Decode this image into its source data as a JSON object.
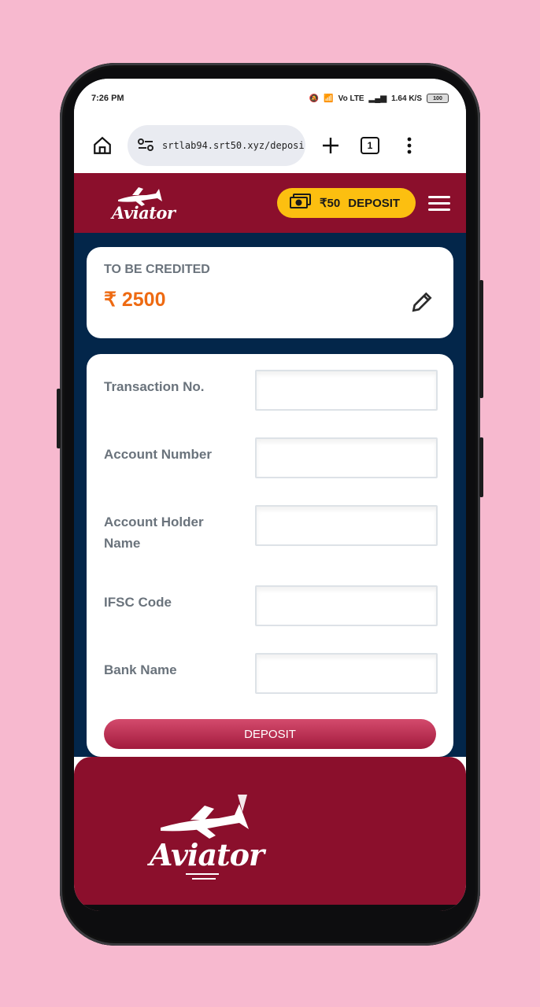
{
  "status_bar": {
    "time": "7:26 PM",
    "network": "Vo LTE",
    "speed": "1.64 K/S",
    "battery": "100"
  },
  "browser": {
    "url": "srtlab94.srt50.xyz/deposi",
    "tab_count": "1"
  },
  "app_header": {
    "logo_text": "Aviator",
    "balance": "₹50",
    "deposit_label": "DEPOSIT"
  },
  "credit": {
    "label": "TO BE CREDITED",
    "amount": "₹ 2500"
  },
  "form": {
    "fields": [
      {
        "label": "Transaction No.",
        "value": ""
      },
      {
        "label": "Account Number",
        "value": ""
      },
      {
        "label": "Account Holder Name",
        "value": ""
      },
      {
        "label": "IFSC Code",
        "value": ""
      },
      {
        "label": "Bank Name",
        "value": ""
      }
    ],
    "submit_label": "DEPOSIT"
  },
  "footer": {
    "logo_text": "Aviator"
  },
  "colors": {
    "brand": "#8b0f2c",
    "accent": "#fcbf10",
    "amount": "#ee6a12",
    "background": "#03264a",
    "page": "#f7b9cf"
  }
}
